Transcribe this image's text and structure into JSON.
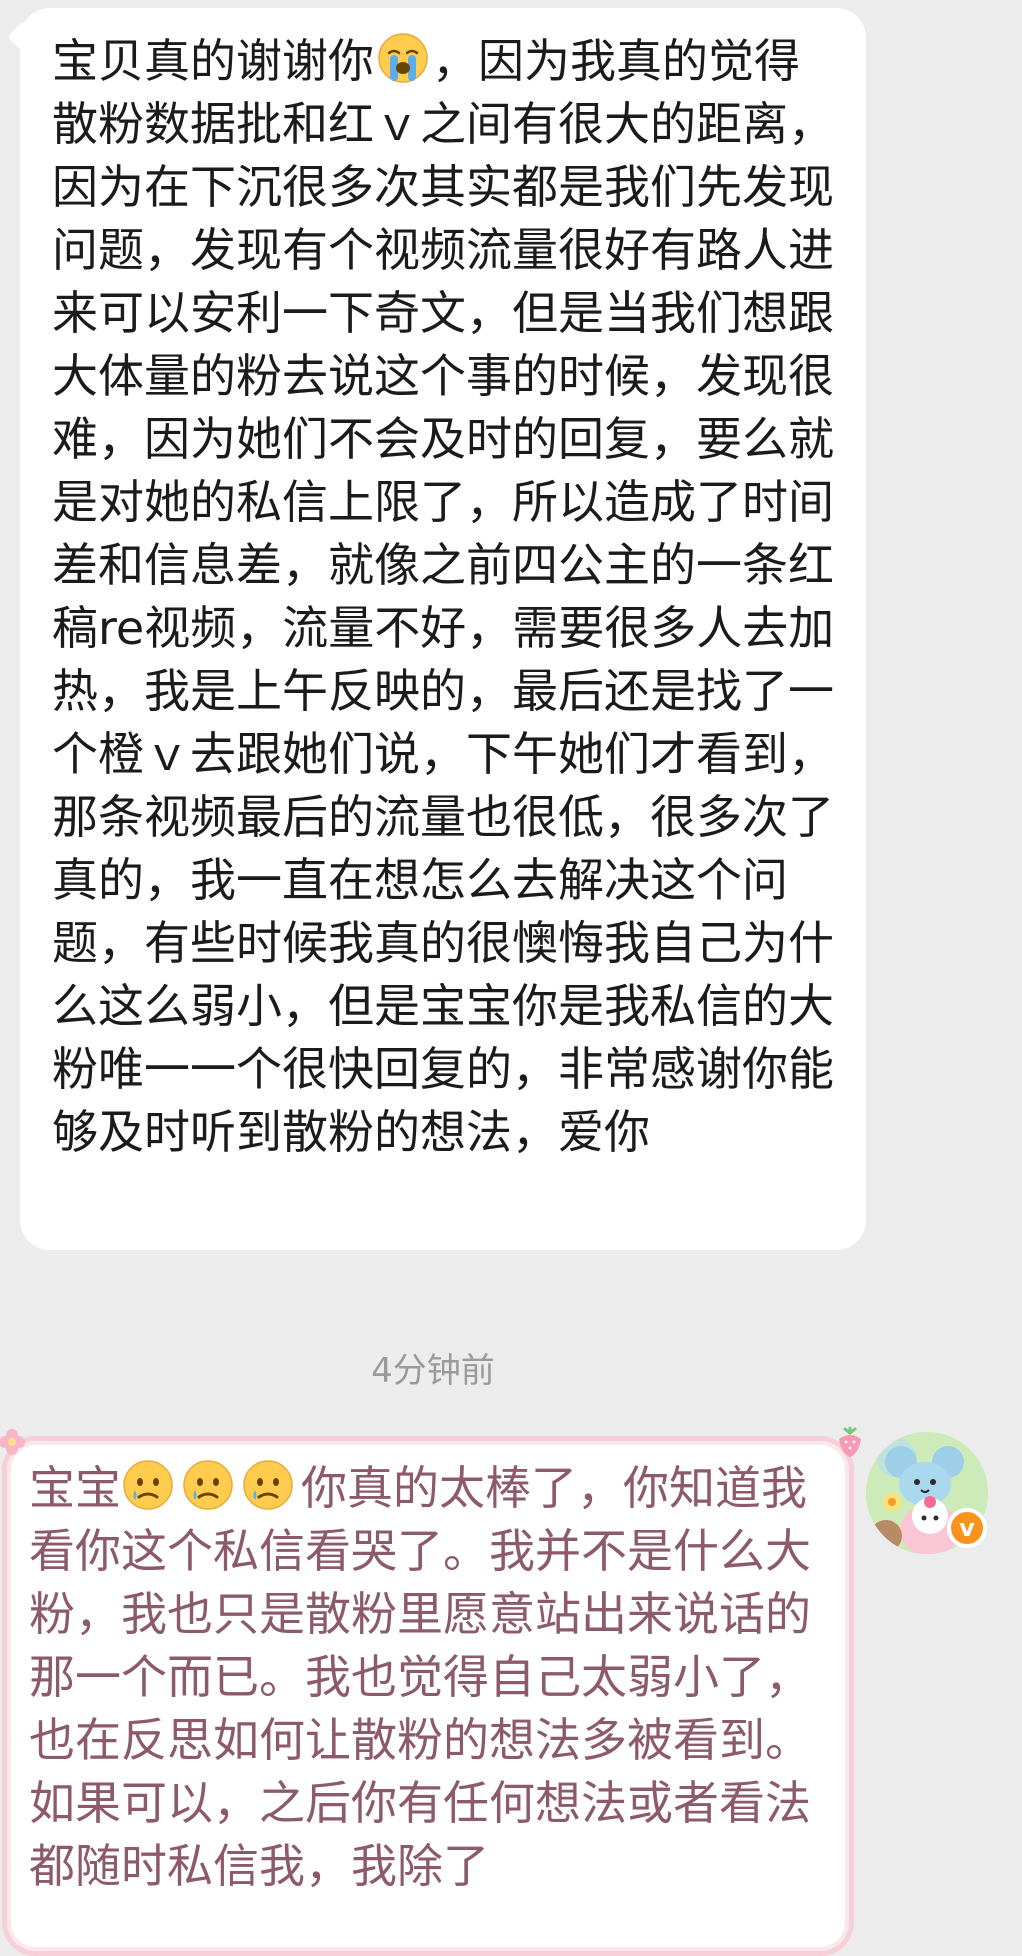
{
  "incoming_message": {
    "prefix": "宝贝真的谢谢你",
    "emoji": "loudly-crying-face-icon",
    "body": "，因为我真的觉得散粉数据批和红ｖ之间有很大的距离，因为在下沉很多次其实都是我们先发现问题，发现有个视频流量很好有路人进来可以安利一下奇文，但是当我们想跟大体量的粉去说这个事的时候，发现很难，因为她们不会及时的回复，要么就是对她的私信上限了，所以造成了时间差和信息差，就像之前四公主的一条红稿re视频，流量不好，需要很多人去加热，我是上午反映的，最后还是找了一个橙ｖ去跟她们说，下午她们才看到，那条视频最后的流量也很低，很多次了真的，我一直在想怎么去解决这个问题，有些时候我真的很懊悔我自己为什么这么弱小，但是宝宝你是我私信的大粉唯一一个很快回复的，非常感谢你能够及时听到散粉的想法，爱你"
  },
  "timestamp": "4分钟前",
  "outgoing_message": {
    "prefix": "宝宝",
    "emoji": "sad-tear-face-icon",
    "body": "你真的太棒了，你知道我看你这个私信看哭了。我并不是什么大粉，我也只是散粉里愿意站出来说话的那一个而已。我也觉得自己太弱小了，也在反思如何让散粉的想法多被看到。如果可以，之后你有任何想法或者看法都随时私信我，我除了"
  },
  "avatar": {
    "icon": "cartoon-avatar-icon",
    "badge_icon": "verified-v-badge-icon",
    "badge_letter": "v",
    "badge_color": "#f7931e"
  },
  "colors": {
    "background": "#ececec",
    "incoming_text": "#1b1b1b",
    "outgoing_text": "#8c5a6a",
    "outgoing_border": "#f6cfd9",
    "timestamp": "#9a9a9a"
  }
}
